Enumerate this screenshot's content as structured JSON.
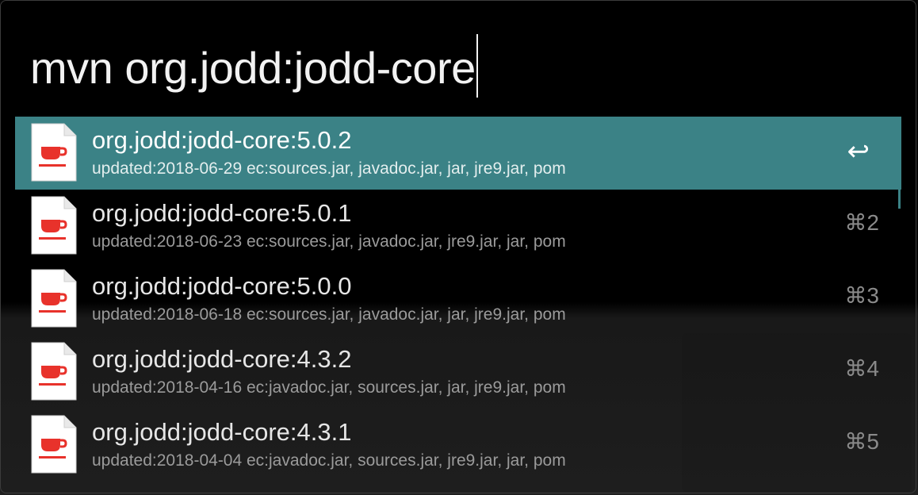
{
  "search": {
    "query": "mvn org.jodd:jodd-core"
  },
  "results": [
    {
      "title": "org.jodd:jodd-core:5.0.2",
      "subtitle": "updated:2018-06-29 ec:sources.jar, javadoc.jar, jar, jre9.jar, pom",
      "shortcut": "↩",
      "icon": "java-file-icon",
      "selected": true
    },
    {
      "title": "org.jodd:jodd-core:5.0.1",
      "subtitle": "updated:2018-06-23 ec:sources.jar, javadoc.jar, jre9.jar, jar, pom",
      "shortcut": "⌘2",
      "icon": "java-file-icon",
      "selected": false
    },
    {
      "title": "org.jodd:jodd-core:5.0.0",
      "subtitle": "updated:2018-06-18 ec:sources.jar, javadoc.jar, jar, jre9.jar, pom",
      "shortcut": "⌘3",
      "icon": "java-file-icon",
      "selected": false
    },
    {
      "title": "org.jodd:jodd-core:4.3.2",
      "subtitle": "updated:2018-04-16 ec:javadoc.jar, sources.jar, jar, jre9.jar, pom",
      "shortcut": "⌘4",
      "icon": "java-file-icon",
      "selected": false
    },
    {
      "title": "org.jodd:jodd-core:4.3.1",
      "subtitle": "updated:2018-04-04 ec:javadoc.jar, sources.jar, jre9.jar, jar, pom",
      "shortcut": "⌘5",
      "icon": "java-file-icon",
      "selected": false
    }
  ],
  "colors": {
    "selection": "#3b8286",
    "icon_red": "#e8322b"
  }
}
